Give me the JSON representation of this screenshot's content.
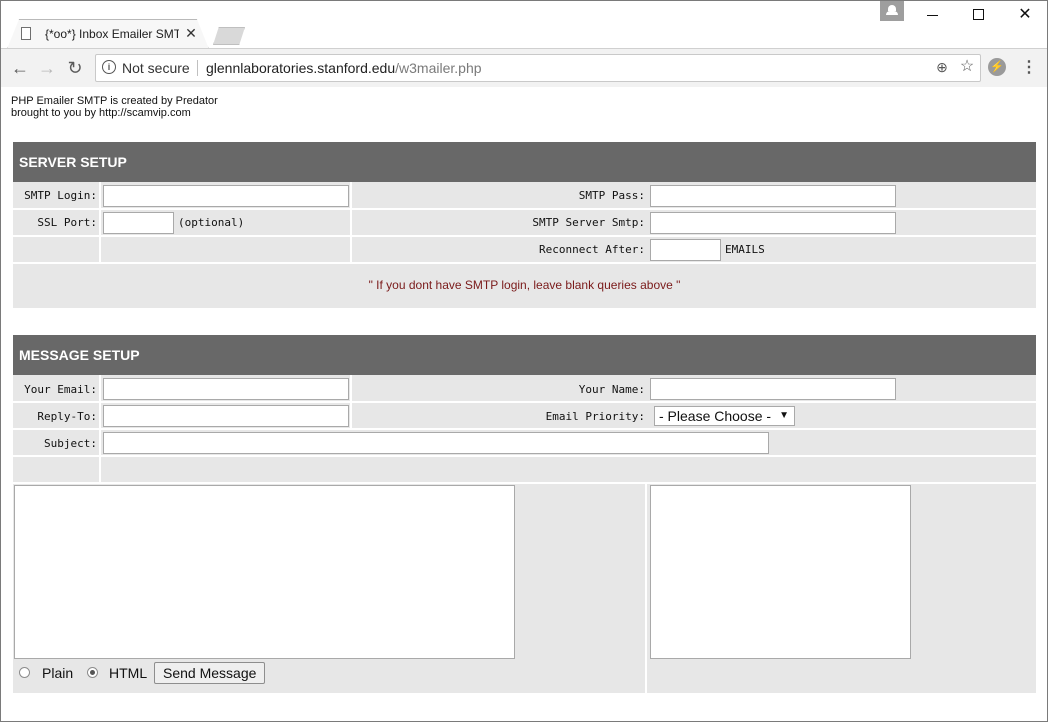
{
  "browser": {
    "tab_title": "{*oo*} Inbox Emailer SMTP",
    "security_label": "Not secure",
    "url_host": "glennlaboratories.stanford.edu",
    "url_path": "/w3mailer.php"
  },
  "credit": {
    "line1": "PHP Emailer SMTP is created by Predator",
    "line2": "brought to you by http://scamvip.com"
  },
  "server_setup": {
    "title": "SERVER SETUP",
    "smtp_login_label": "SMTP Login:",
    "smtp_pass_label": "SMTP Pass:",
    "ssl_port_label": "SSL Port:",
    "ssl_port_hint": "(optional)",
    "smtp_server_label": "SMTP Server Smtp:",
    "reconnect_label": "Reconnect After:",
    "reconnect_unit": "EMAILS",
    "note": "\" If you dont have SMTP login, leave blank queries above \""
  },
  "message_setup": {
    "title": "MESSAGE SETUP",
    "your_email_label": "Your Email:",
    "your_name_label": "Your Name:",
    "reply_to_label": "Reply-To:",
    "priority_label": "Email Priority:",
    "priority_selected": "- Please Choose -",
    "subject_label": "Subject:",
    "format_plain": "Plain",
    "format_html": "HTML",
    "selected_format": "HTML",
    "send_label": "Send Message"
  },
  "colors": {
    "header_bg": "#686868",
    "row_bg": "#e7e7e7",
    "note_text": "#7a1a1a"
  }
}
